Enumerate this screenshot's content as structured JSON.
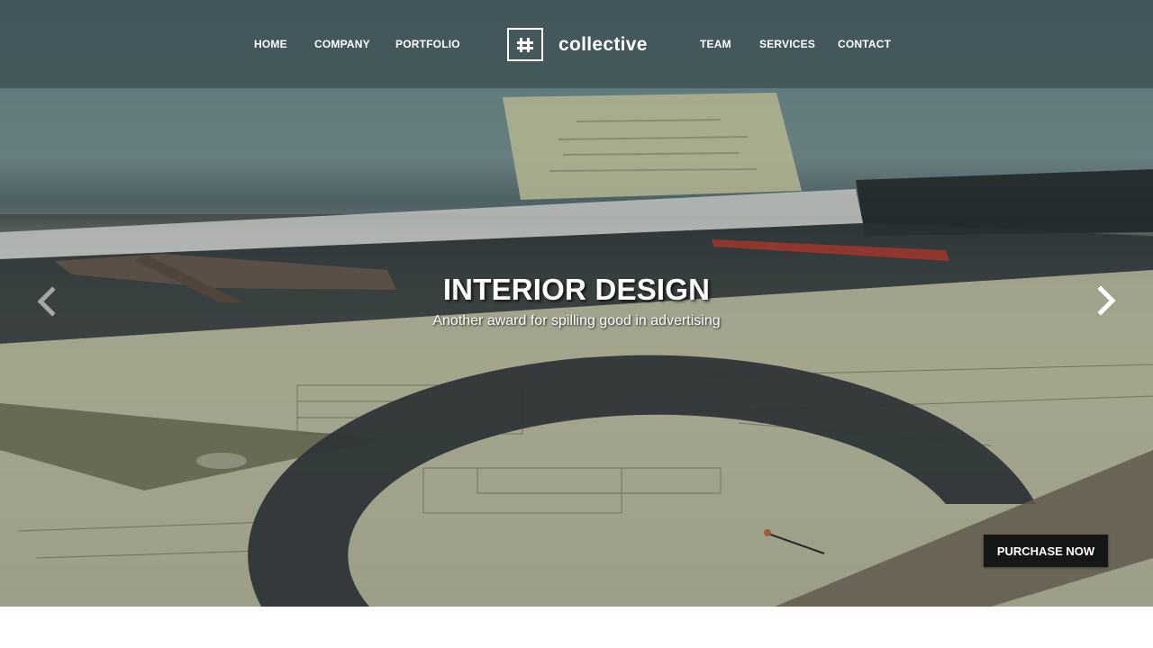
{
  "nav": {
    "left": [
      "HOME",
      "COMPANY",
      "PORTFOLIO"
    ],
    "right": [
      "TEAM",
      "SERVICES",
      "CONTACT"
    ]
  },
  "logo": {
    "name": "collective",
    "icon": "grid-mark-icon"
  },
  "hero": {
    "title": "INTERIOR DESIGN",
    "subtitle": "Another award for spilling good in advertising",
    "prev_icon": "chevron-left-icon",
    "next_icon": "chevron-right-icon",
    "cta_label": "PURCHASE NOW"
  },
  "colors": {
    "header_bg": "#3e5054",
    "text": "#ffffff",
    "cta_bg": "#151616"
  }
}
